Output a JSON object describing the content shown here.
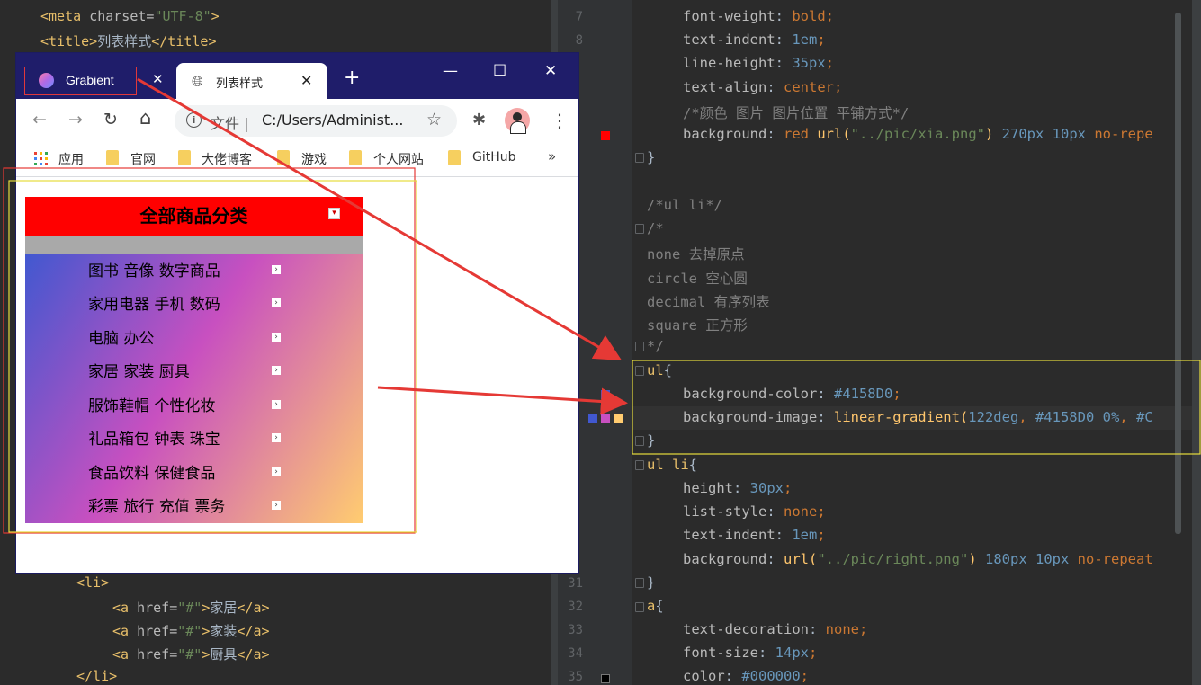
{
  "left_editor": {
    "top_lines": [
      {
        "tag_open": "<meta ",
        "attr": "charset=",
        "value": "\"UTF-8\"",
        "tag_close": ">"
      },
      {
        "tag_open": "<title>",
        "text": "列表样式",
        "tag_close": "</title>"
      }
    ],
    "bottom_lines": [
      {
        "tag": "<li>"
      },
      {
        "tag_open": "<a ",
        "attr": "href=",
        "value": "\"#\"",
        "gt": ">",
        "text": "家居",
        "tag_close": "</a>"
      },
      {
        "tag_open": "<a ",
        "attr": "href=",
        "value": "\"#\"",
        "gt": ">",
        "text": "家装",
        "tag_close": "</a>"
      },
      {
        "tag_open": "<a ",
        "attr": "href=",
        "value": "\"#\"",
        "gt": ">",
        "text": "厨具",
        "tag_close": "</a>"
      },
      {
        "tag": "</li>"
      }
    ]
  },
  "right_editor": {
    "line_numbers": [
      "7",
      "8",
      "31",
      "32",
      "33",
      "34",
      "35"
    ],
    "lines": {
      "l7": {
        "prop": "font-weight",
        "value": "bold"
      },
      "l8": {
        "prop": "text-indent",
        "num": "1em"
      },
      "l9": {
        "prop": "line-height",
        "num": "35px"
      },
      "l10": {
        "prop": "text-align",
        "value": "center"
      },
      "l11": {
        "comment": "/*颜色 图片 图片位置 平铺方式*/"
      },
      "l12": {
        "prop": "background",
        "value": "red",
        "fn": "url(",
        "str": "\"../pic/xia.png\"",
        "fn_close": ")",
        "num": "270px 10px",
        "rest": "no-repe"
      },
      "l13": {
        "brace": "}"
      },
      "l15": {
        "comment": "/*ul li*/"
      },
      "l16": {
        "comment": "/*"
      },
      "l17": {
        "comment": "none 去掉原点"
      },
      "l18": {
        "comment": "circle 空心圆"
      },
      "l19": {
        "comment": "decimal 有序列表"
      },
      "l20": {
        "comment": "square 正方形"
      },
      "l21": {
        "comment": "*/"
      },
      "l22": {
        "selector": "ul",
        "brace": "{"
      },
      "l23": {
        "prop": "background-color",
        "value": "#4158D0"
      },
      "l24": {
        "prop": "background-image",
        "fn": "linear-gradient(",
        "num": "122deg",
        "value": "#4158D0 0%",
        "rest": "#C"
      },
      "l25": {
        "brace": "}"
      },
      "l26": {
        "selector": "ul li",
        "brace": "{"
      },
      "l27": {
        "prop": "height",
        "num": "30px"
      },
      "l28": {
        "prop": "list-style",
        "value": "none"
      },
      "l29": {
        "prop": "text-indent",
        "num": "1em"
      },
      "l30": {
        "prop": "background",
        "fn": "url(",
        "str": "\"../pic/right.png\"",
        "fn_close": ")",
        "num": "180px 10px",
        "rest": "no-repeat"
      },
      "l31": {
        "brace": "}"
      },
      "l32": {
        "selector": "a",
        "brace": "{"
      },
      "l33": {
        "prop": "text-decoration",
        "value": "none"
      },
      "l34": {
        "prop": "font-size",
        "num": "14px"
      },
      "l35": {
        "prop": "color",
        "value": "#000000"
      }
    },
    "punct": {
      "colon": ": ",
      "semi": ";",
      "comma": ", "
    }
  },
  "browser": {
    "tabs": [
      {
        "label": "Grabient",
        "close": "✕"
      },
      {
        "label": "列表样式",
        "close": "✕"
      }
    ],
    "new_tab": "+",
    "window_controls": {
      "minimize": "—",
      "maximize": "☐",
      "close": "✕"
    },
    "nav": {
      "back": "←",
      "forward": "→",
      "reload": "↻",
      "home": "⌂"
    },
    "address": {
      "scheme_label": "文件",
      "separator": "|",
      "url": "C:/Users/Administ...",
      "info": "i",
      "star": "☆"
    },
    "extensions": {
      "puzzle": "✱",
      "menu": "⋮"
    },
    "bookmarks": [
      {
        "label": "应用"
      },
      {
        "label": "官网"
      },
      {
        "label": "大佬博客"
      },
      {
        "label": "游戏"
      },
      {
        "label": "个人网站"
      },
      {
        "label": "GitHub"
      }
    ],
    "bookmarks_more": "»",
    "page": {
      "header_title": "全部商品分类",
      "header_caret": "▾",
      "categories": [
        "图书 音像 数字商品",
        "家用电器 手机 数码",
        "电脑 办公",
        "家居 家装 厨具",
        "服饰鞋帽 个性化妆",
        "礼品箱包 钟表 珠宝",
        "食品饮料 保健食品",
        "彩票 旅行 充值 票务"
      ],
      "arrow_glyph": "›",
      "colors": {
        "header": "#ff0000",
        "gray_band": "#a9a9a9",
        "gradient_start": "#4158D0",
        "gradient_mid": "#C850C0",
        "gradient_end": "#FFCC70"
      }
    }
  },
  "annotation_colors": {
    "arrow": "#e53935",
    "red_box": "#e53935",
    "yellow_box": "#e6dc3c"
  }
}
